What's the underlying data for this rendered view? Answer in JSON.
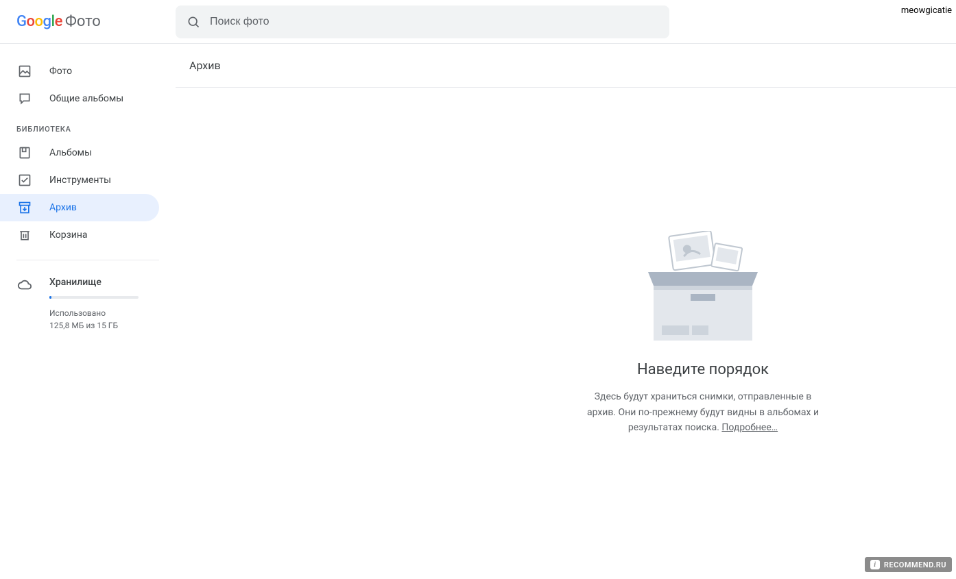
{
  "header": {
    "logo_product": "Фото",
    "search_placeholder": "Поиск фото",
    "user_label": "meowgicatie"
  },
  "sidebar": {
    "items_top": [
      {
        "label": "Фото",
        "icon": "image-icon"
      },
      {
        "label": "Общие альбомы",
        "icon": "chat-icon"
      }
    ],
    "section_label": "БИБЛИОТЕКА",
    "items_lib": [
      {
        "label": "Альбомы",
        "icon": "album-icon"
      },
      {
        "label": "Инструменты",
        "icon": "tools-icon"
      },
      {
        "label": "Архив",
        "icon": "archive-icon",
        "active": true
      },
      {
        "label": "Корзина",
        "icon": "trash-icon"
      }
    ],
    "storage": {
      "title": "Хранилище",
      "usage_label": "Использовано",
      "usage_value": "125,8 МБ из 15 ГБ",
      "fill_percent": 0.84
    }
  },
  "main": {
    "title": "Архив",
    "empty": {
      "heading": "Наведите порядок",
      "body": "Здесь будут храниться снимки, отправленные в архив. Они по-прежнему будут видны в альбомах и результатах поиска. ",
      "link": "Подробнее…"
    }
  },
  "watermark": "RECOMMEND.RU"
}
